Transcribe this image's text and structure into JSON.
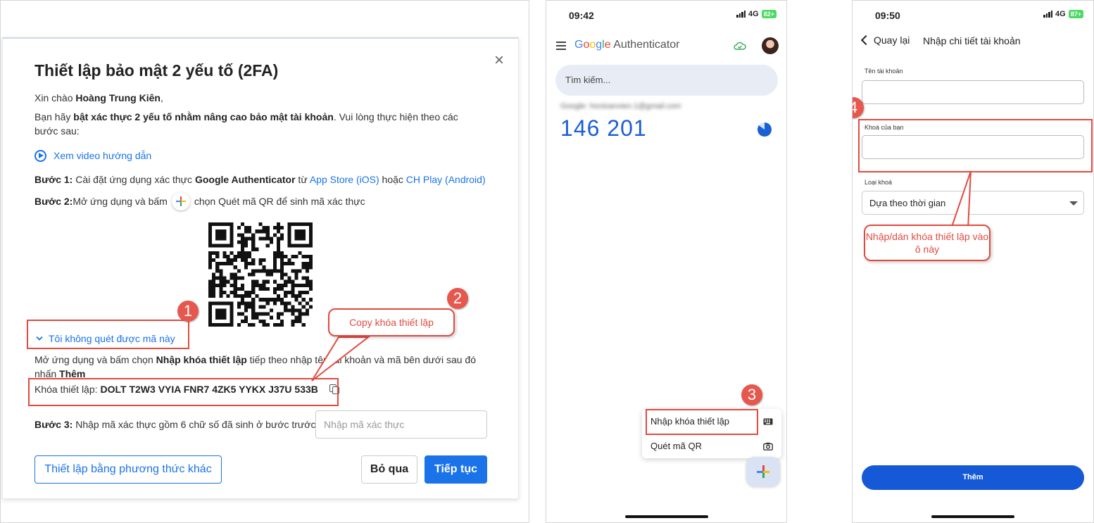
{
  "dialog": {
    "title": "Thiết lập bảo mật 2 yếu tố (2FA)",
    "greeting_prefix": "Xin chào ",
    "user_name": "Hoàng Trung Kiên",
    "greeting_suffix": ",",
    "intro_prefix": "Bạn hãy ",
    "intro_bold": "bật xác thực 2 yếu tố nhằm nâng cao bảo mật tài khoản",
    "intro_suffix": ". Vui lòng thực hiện theo các bước sau:",
    "video_link": "Xem video hướng dẫn",
    "step1_label": "Bước 1:",
    "step1_text": " Cài đặt ứng dụng xác thực ",
    "step1_app": "Google Authenticator",
    "step1_from": " từ ",
    "step1_appstore": "App Store (iOS)",
    "step1_or": " hoặc ",
    "step1_chplay": "CH Play (Android)",
    "step2_label": "Bước 2:",
    "step2_text_a": " Mở ứng dụng và bấm",
    "step2_text_b": "chọn Quét mã QR để sinh mã xác thực",
    "cant_scan_link": "Tôi không quét được mã này",
    "note_prefix": "Mở ứng dụng và bấm chọn ",
    "note_bold": "Nhập khóa thiết lập",
    "note_middle": " tiếp theo nhập tên tài khoản và mã bên dưới sau đó nhấn ",
    "note_add": "Thêm",
    "key_label": "Khóa thiết lập:",
    "key_value": "DOLT T2W3 VYIA FNR7 4ZK5 YYKX J37U 533B",
    "step3_label": "Bước 3:",
    "step3_text": " Nhập mã xác thực gồm 6 chữ số đã sinh ở bước trước",
    "otp_placeholder": "Nhập mã xác thực",
    "btn_other": "Thiết lập bằng phương thức khác",
    "btn_skip": "Bỏ qua",
    "btn_next": "Tiếp tục"
  },
  "annotations": {
    "badge1": "1",
    "badge2": "2",
    "badge3": "3",
    "badge4": "4",
    "callout_copy": "Copy khóa thiết lập",
    "callout_paste": "Nhập/dán khóa thiết lập vào ô này"
  },
  "phone1": {
    "time": "09:42",
    "network": "4G",
    "battery": "82+",
    "app_title_google": "Google",
    "app_title_rest": " Authenticator",
    "search_placeholder": "Tìm kiếm...",
    "account_email": "Google: hoctoanvien.1@gmail.com",
    "otp_code": "146 201",
    "menu_enter_key": "Nhập khóa thiết lập",
    "menu_scan_qr": "Quét mã QR"
  },
  "phone2": {
    "time": "09:50",
    "network": "4G",
    "battery": "87+",
    "back_label": "Quay lại",
    "title": "Nhập chi tiết tài khoản",
    "account_name_label": "Tên tài khoản",
    "your_key_label": "Khoá của bạn",
    "key_type_label": "Loại khoá",
    "key_type_value": "Dựa theo thời gian",
    "add_button": "Thêm"
  },
  "colors": {
    "accent": "#1a73e8",
    "annotation_red": "#e04b41",
    "otp_blue": "#1a5fd6"
  },
  "icons": [
    "close-icon",
    "play-icon",
    "google-plus-icon",
    "qr-code",
    "chevron-down-icon",
    "copy-icon",
    "menu-icon",
    "cloud-check-icon",
    "timer-icon",
    "keyboard-icon",
    "camera-icon",
    "chevron-left-icon"
  ]
}
